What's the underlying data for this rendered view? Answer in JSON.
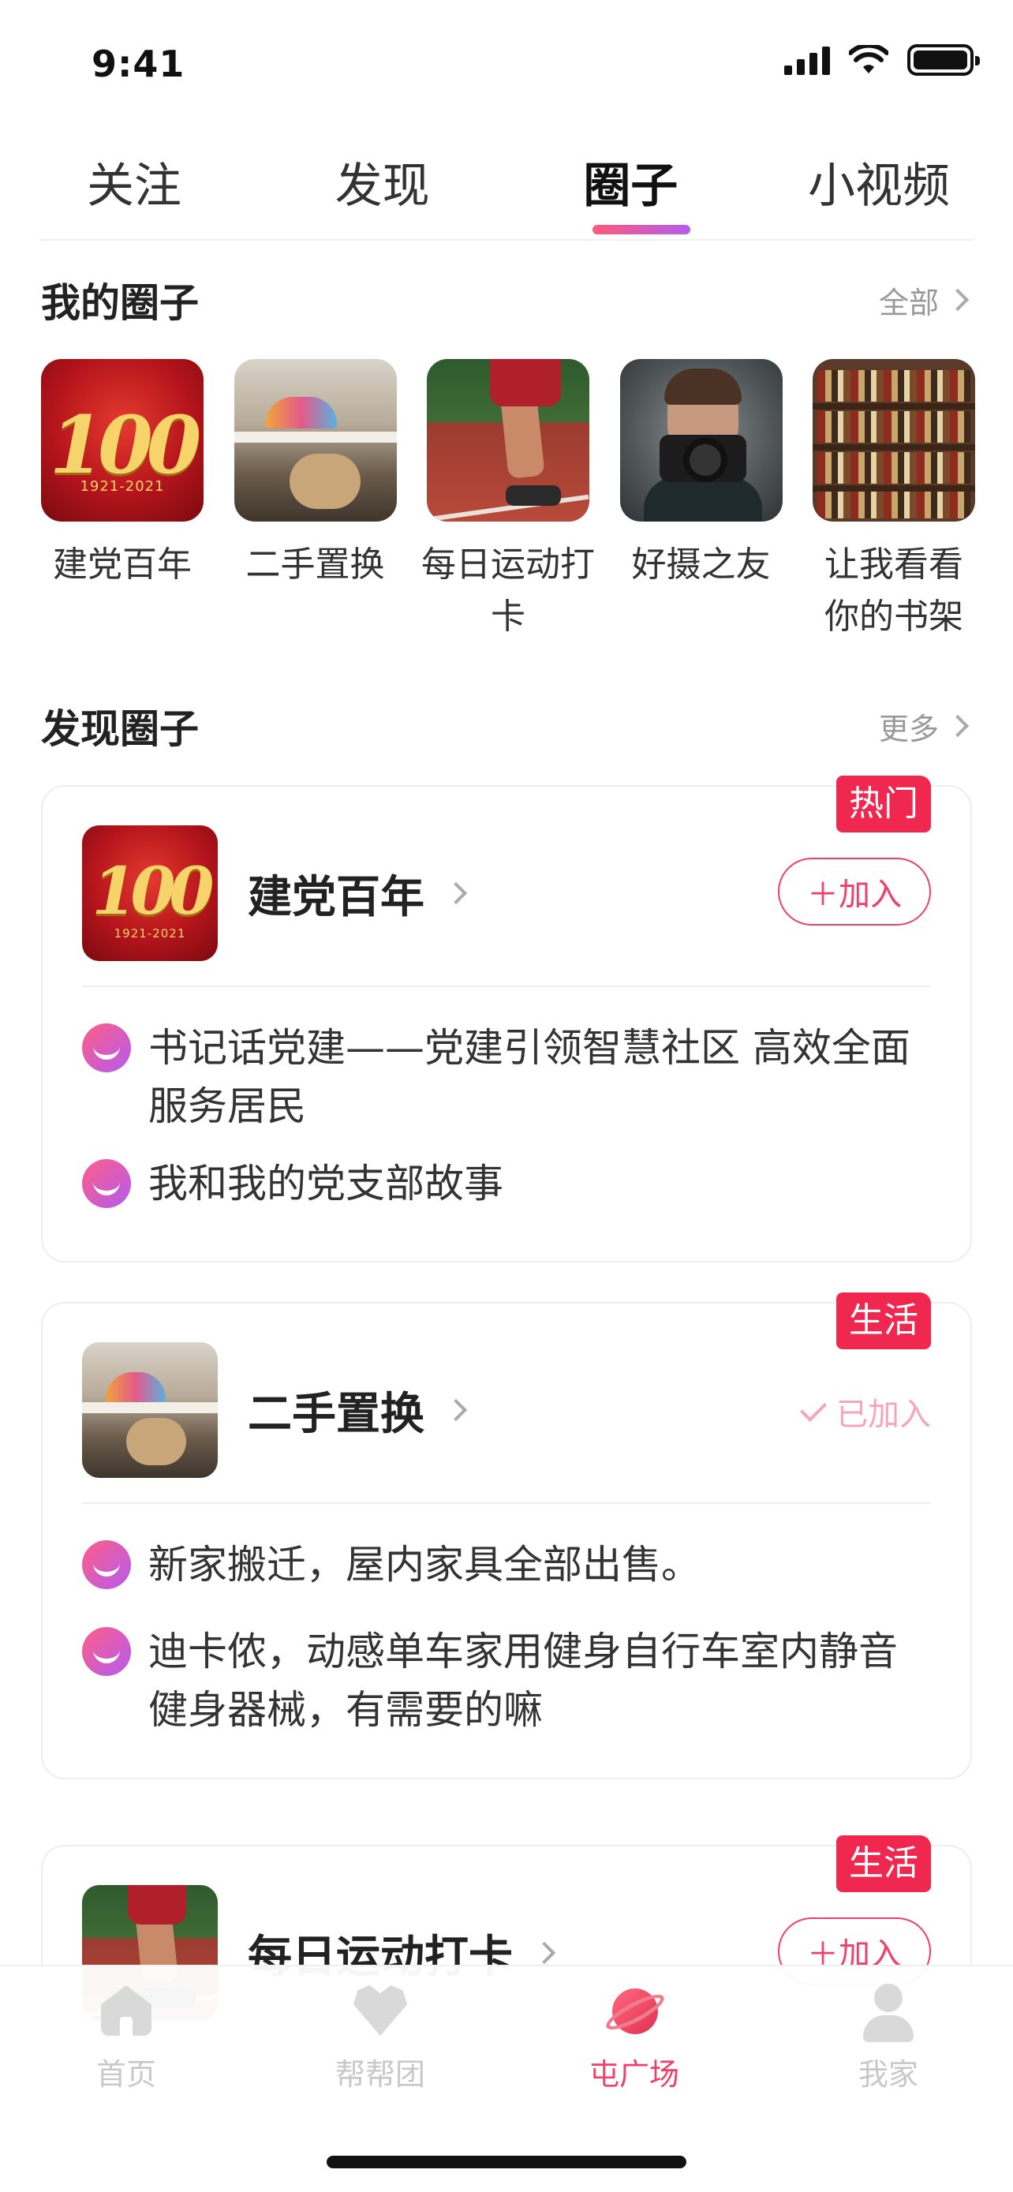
{
  "status_bar": {
    "time": "9:41"
  },
  "top_tabs": [
    {
      "label": "关注",
      "active": false
    },
    {
      "label": "发现",
      "active": false
    },
    {
      "label": "圈子",
      "active": true
    },
    {
      "label": "小视频",
      "active": false
    }
  ],
  "my_circles": {
    "title": "我的圈子",
    "more_label": "全部",
    "items": [
      {
        "name": "建党百年",
        "thumb_text": "100",
        "thumb_years": "1921-2021"
      },
      {
        "name": "二手置换"
      },
      {
        "name": "每日运动打卡"
      },
      {
        "name": "好摄之友"
      },
      {
        "name": "让我看看你的书架"
      }
    ]
  },
  "discover": {
    "title": "发现圈子",
    "more_label": "更多",
    "cards": [
      {
        "tag": "热门",
        "title": "建党百年",
        "action": "＋加入",
        "joined": false,
        "posts": [
          "书记话党建——党建引领智慧社区 高效全面服务居民",
          "我和我的党支部故事"
        ]
      },
      {
        "tag": "生活",
        "title": "二手置换",
        "action": "已加入",
        "joined": true,
        "posts": [
          "新家搬迁，屋内家具全部出售。",
          "迪卡侬，动感单车家用健身自行车室内静音健身器械，有需要的嘛"
        ]
      },
      {
        "tag": "生活",
        "title": "每日运动打卡",
        "action": "＋加入",
        "joined": false,
        "posts": []
      }
    ]
  },
  "bottom_nav": [
    {
      "label": "首页",
      "icon": "home-icon",
      "active": false
    },
    {
      "label": "帮帮团",
      "icon": "heart-hands-icon",
      "active": false
    },
    {
      "label": "屯广场",
      "icon": "planet-icon",
      "active": true
    },
    {
      "label": "我家",
      "icon": "user-icon",
      "active": false
    }
  ],
  "colors": {
    "accent": "#f0406a",
    "tag": "#f0284f",
    "joined": "#f7a6ba",
    "tab_underline_start": "#ff5a7a",
    "tab_underline_end": "#b45cf0"
  }
}
